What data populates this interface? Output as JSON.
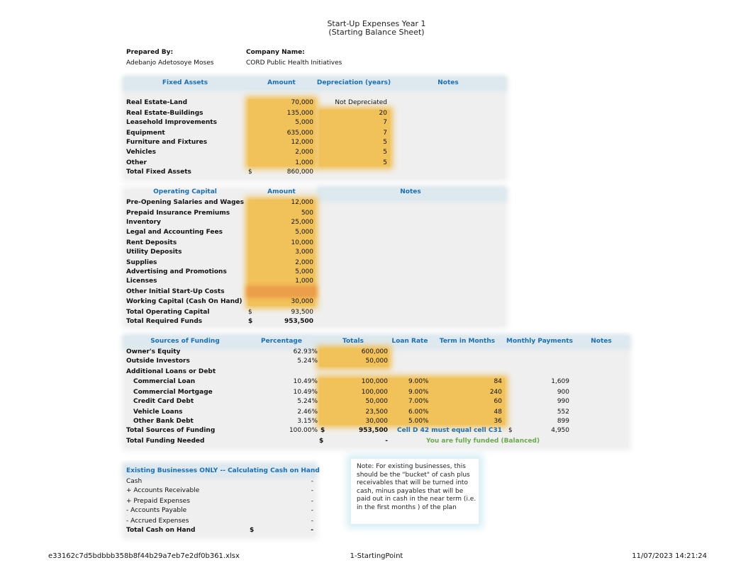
{
  "title": {
    "line1": "Start-Up Expenses Year 1",
    "line2": "(Starting Balance Sheet)"
  },
  "meta": {
    "prepared_by_label": "Prepared By:",
    "prepared_by_value": "Adebanjo Adetosoye Moses",
    "company_label": "Company Name:",
    "company_value": "CORD Public Health Initiatives"
  },
  "fixed_assets": {
    "headers": [
      "Fixed Assets",
      "Amount",
      "Depreciation (years)",
      "Notes"
    ],
    "rows": [
      {
        "label": "Real Estate-Land",
        "amount": "70,000",
        "depr": "Not Depreciated"
      },
      {
        "label": "Real Estate-Buildings",
        "amount": "135,000",
        "depr": "20"
      },
      {
        "label": "Leasehold Improvements",
        "amount": "5,000",
        "depr": "7"
      },
      {
        "label": "Equipment",
        "amount": "635,000",
        "depr": "7"
      },
      {
        "label": "Furniture and Fixtures",
        "amount": "12,000",
        "depr": "5"
      },
      {
        "label": "Vehicles",
        "amount": "2,000",
        "depr": "5"
      },
      {
        "label": "Other",
        "amount": "1,000",
        "depr": "5"
      }
    ],
    "total_label": "Total Fixed Assets",
    "total_currency": "$",
    "total_value": "860,000"
  },
  "operating_capital": {
    "headers": [
      "Operating Capital",
      "Amount",
      "Notes"
    ],
    "rows": [
      {
        "label": "Pre-Opening Salaries and Wages",
        "amount": "12,000"
      },
      {
        "label": "Prepaid Insurance Premiums",
        "amount": "500"
      },
      {
        "label": "Inventory",
        "amount": "25,000"
      },
      {
        "label": "Legal and Accounting Fees",
        "amount": "5,000"
      },
      {
        "label": "Rent Deposits",
        "amount": "10,000"
      },
      {
        "label": "Utility Deposits",
        "amount": "3,000"
      },
      {
        "label": "Supplies",
        "amount": "2,000"
      },
      {
        "label": "Advertising and Promotions",
        "amount": "5,000"
      },
      {
        "label": "Licenses",
        "amount": "1,000"
      },
      {
        "label": "Other Initial Start-Up Costs",
        "amount": ""
      },
      {
        "label": "Working Capital (Cash On Hand)",
        "amount": "30,000"
      }
    ],
    "total_label": "Total Operating Capital",
    "total_currency": "$",
    "total_value": "93,500",
    "required_label": "Total Required Funds",
    "required_currency": "$",
    "required_value": "953,500"
  },
  "funding": {
    "headers": [
      "Sources of Funding",
      "Percentage",
      "Totals",
      "Loan Rate",
      "Term in Months",
      "Monthly Payments",
      "Notes"
    ],
    "rows": [
      {
        "label": "Owner's Equity",
        "pct": "62.93%",
        "total": "600,000",
        "rate": "",
        "term": "",
        "payment": "",
        "indent": false
      },
      {
        "label": "Outside Investors",
        "pct": "5.24%",
        "total": "50,000",
        "rate": "",
        "term": "",
        "payment": "",
        "indent": false
      },
      {
        "label": "Additional Loans or Debt",
        "pct": "",
        "total": "",
        "rate": "",
        "term": "",
        "payment": "",
        "indent": false
      },
      {
        "label": "Commercial Loan",
        "pct": "10.49%",
        "total": "100,000",
        "rate": "9.00%",
        "term": "84",
        "payment": "1,609",
        "indent": true
      },
      {
        "label": "Commercial Mortgage",
        "pct": "10.49%",
        "total": "100,000",
        "rate": "9.00%",
        "term": "240",
        "payment": "900",
        "indent": true
      },
      {
        "label": "Credit Card Debt",
        "pct": "5.24%",
        "total": "50,000",
        "rate": "7.00%",
        "term": "60",
        "payment": "990",
        "indent": true
      },
      {
        "label": "Vehicle Loans",
        "pct": "2.46%",
        "total": "23,500",
        "rate": "6.00%",
        "term": "48",
        "payment": "552",
        "indent": true
      },
      {
        "label": "Other Bank Debt",
        "pct": "3.15%",
        "total": "30,000",
        "rate": "5.00%",
        "term": "36",
        "payment": "899",
        "indent": true
      }
    ],
    "total_label": "Total Sources of Funding",
    "total_pct": "100.00%",
    "total_currency": "$",
    "total_value": "953,500",
    "check_note": "Cell D 42 must equal cell C31",
    "payment_currency": "$",
    "payment_total": "4,950",
    "needed_label": "Total Funding Needed",
    "needed_currency": "$",
    "needed_value": "-",
    "status": "You are fully funded (Balanced)"
  },
  "cash_on_hand": {
    "header": "Existing Businesses ONLY -- Calculating Cash on Hand",
    "rows": [
      {
        "label": "Cash",
        "value": "-"
      },
      {
        "label": "+ Accounts Receivable",
        "value": "-"
      },
      {
        "label": "+ Prepaid Expenses",
        "value": "-"
      },
      {
        "label": "- Accounts Payable",
        "value": "-"
      },
      {
        "label": "- Accrued Expenses",
        "value": "-"
      }
    ],
    "total_label": "Total Cash on Hand",
    "total_currency": "$",
    "total_value": "-"
  },
  "note": "Note: For existing businesses, this should be the \"bucket\"  of cash plus receivables that will be turned into cash, minus payables that will be paid out in cash in the near term (i.e. in the first months ) of the plan",
  "footer": {
    "filename": "e33162c7d5bdbbb358b8f44b29a7eb7e2df0b361.xlsx",
    "sheet": "1-StartingPoint",
    "datetime": "11/07/2023 14:21:24"
  }
}
